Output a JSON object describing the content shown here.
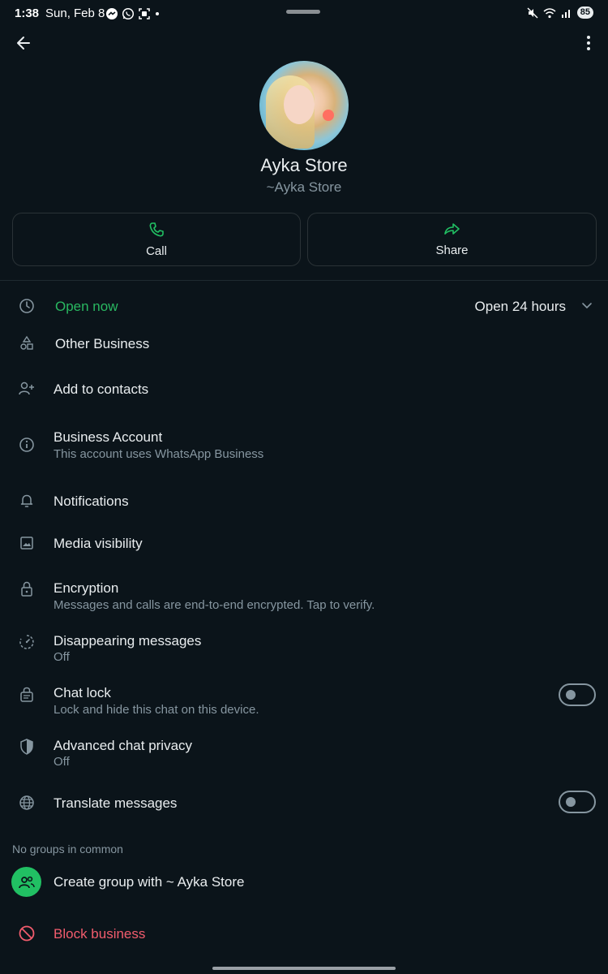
{
  "status": {
    "time": "1:38",
    "date": "Sun, Feb 8",
    "battery": "85"
  },
  "profile": {
    "name": "Ayka Store",
    "subtitle": "~Ayka Store"
  },
  "actions": {
    "call_label": "Call",
    "share_label": "Share"
  },
  "hours": {
    "status": "Open now",
    "hours": "Open 24 hours"
  },
  "rows": {
    "category": "Other Business",
    "add_contacts": "Add to contacts",
    "business_account_title": "Business Account",
    "business_account_sub": "This account uses WhatsApp Business",
    "notifications": "Notifications",
    "media_visibility": "Media visibility",
    "encryption_title": "Encryption",
    "encryption_sub": "Messages and calls are end-to-end encrypted. Tap to verify.",
    "disappearing_title": "Disappearing messages",
    "disappearing_sub": "Off",
    "chat_lock_title": "Chat lock",
    "chat_lock_sub": "Lock and hide this chat on this device.",
    "adv_privacy_title": "Advanced chat privacy",
    "adv_privacy_sub": "Off",
    "translate": "Translate messages"
  },
  "groups": {
    "section_label": "No groups in common",
    "create_label": "Create group with ~ Ayka Store"
  },
  "block": {
    "label": "Block business"
  },
  "colors": {
    "background": "#0b141a",
    "accent_green": "#21c063",
    "danger": "#f15c6d",
    "secondary_text": "#8696a0"
  },
  "toggles": {
    "chat_lock": false,
    "translate_messages": false
  }
}
